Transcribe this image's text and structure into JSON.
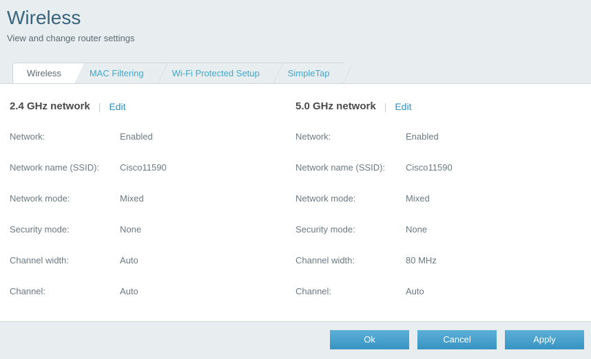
{
  "header": {
    "title": "Wireless",
    "subtitle": "View and change router settings"
  },
  "tabs": [
    {
      "label": "Wireless",
      "active": true
    },
    {
      "label": "MAC Filtering",
      "active": false
    },
    {
      "label": "Wi-Fi Protected Setup",
      "active": false
    },
    {
      "label": "SimpleTap",
      "active": false
    }
  ],
  "network24": {
    "title": "2.4 GHz network",
    "edit_label": "Edit",
    "rows": {
      "network_label": "Network:",
      "network_value": "Enabled",
      "ssid_label": "Network name (SSID):",
      "ssid_value": "Cisco11590",
      "mode_label": "Network mode:",
      "mode_value": "Mixed",
      "security_label": "Security mode:",
      "security_value": "None",
      "width_label": "Channel width:",
      "width_value": "Auto",
      "channel_label": "Channel:",
      "channel_value": "Auto"
    }
  },
  "network50": {
    "title": "5.0 GHz network",
    "edit_label": "Edit",
    "rows": {
      "network_label": "Network:",
      "network_value": "Enabled",
      "ssid_label": "Network name (SSID):",
      "ssid_value": "Cisco11590",
      "mode_label": "Network mode:",
      "mode_value": "Mixed",
      "security_label": "Security mode:",
      "security_value": "None",
      "width_label": "Channel width:",
      "width_value": "80 MHz",
      "channel_label": "Channel:",
      "channel_value": "Auto"
    }
  },
  "footer": {
    "ok": "Ok",
    "cancel": "Cancel",
    "apply": "Apply"
  }
}
